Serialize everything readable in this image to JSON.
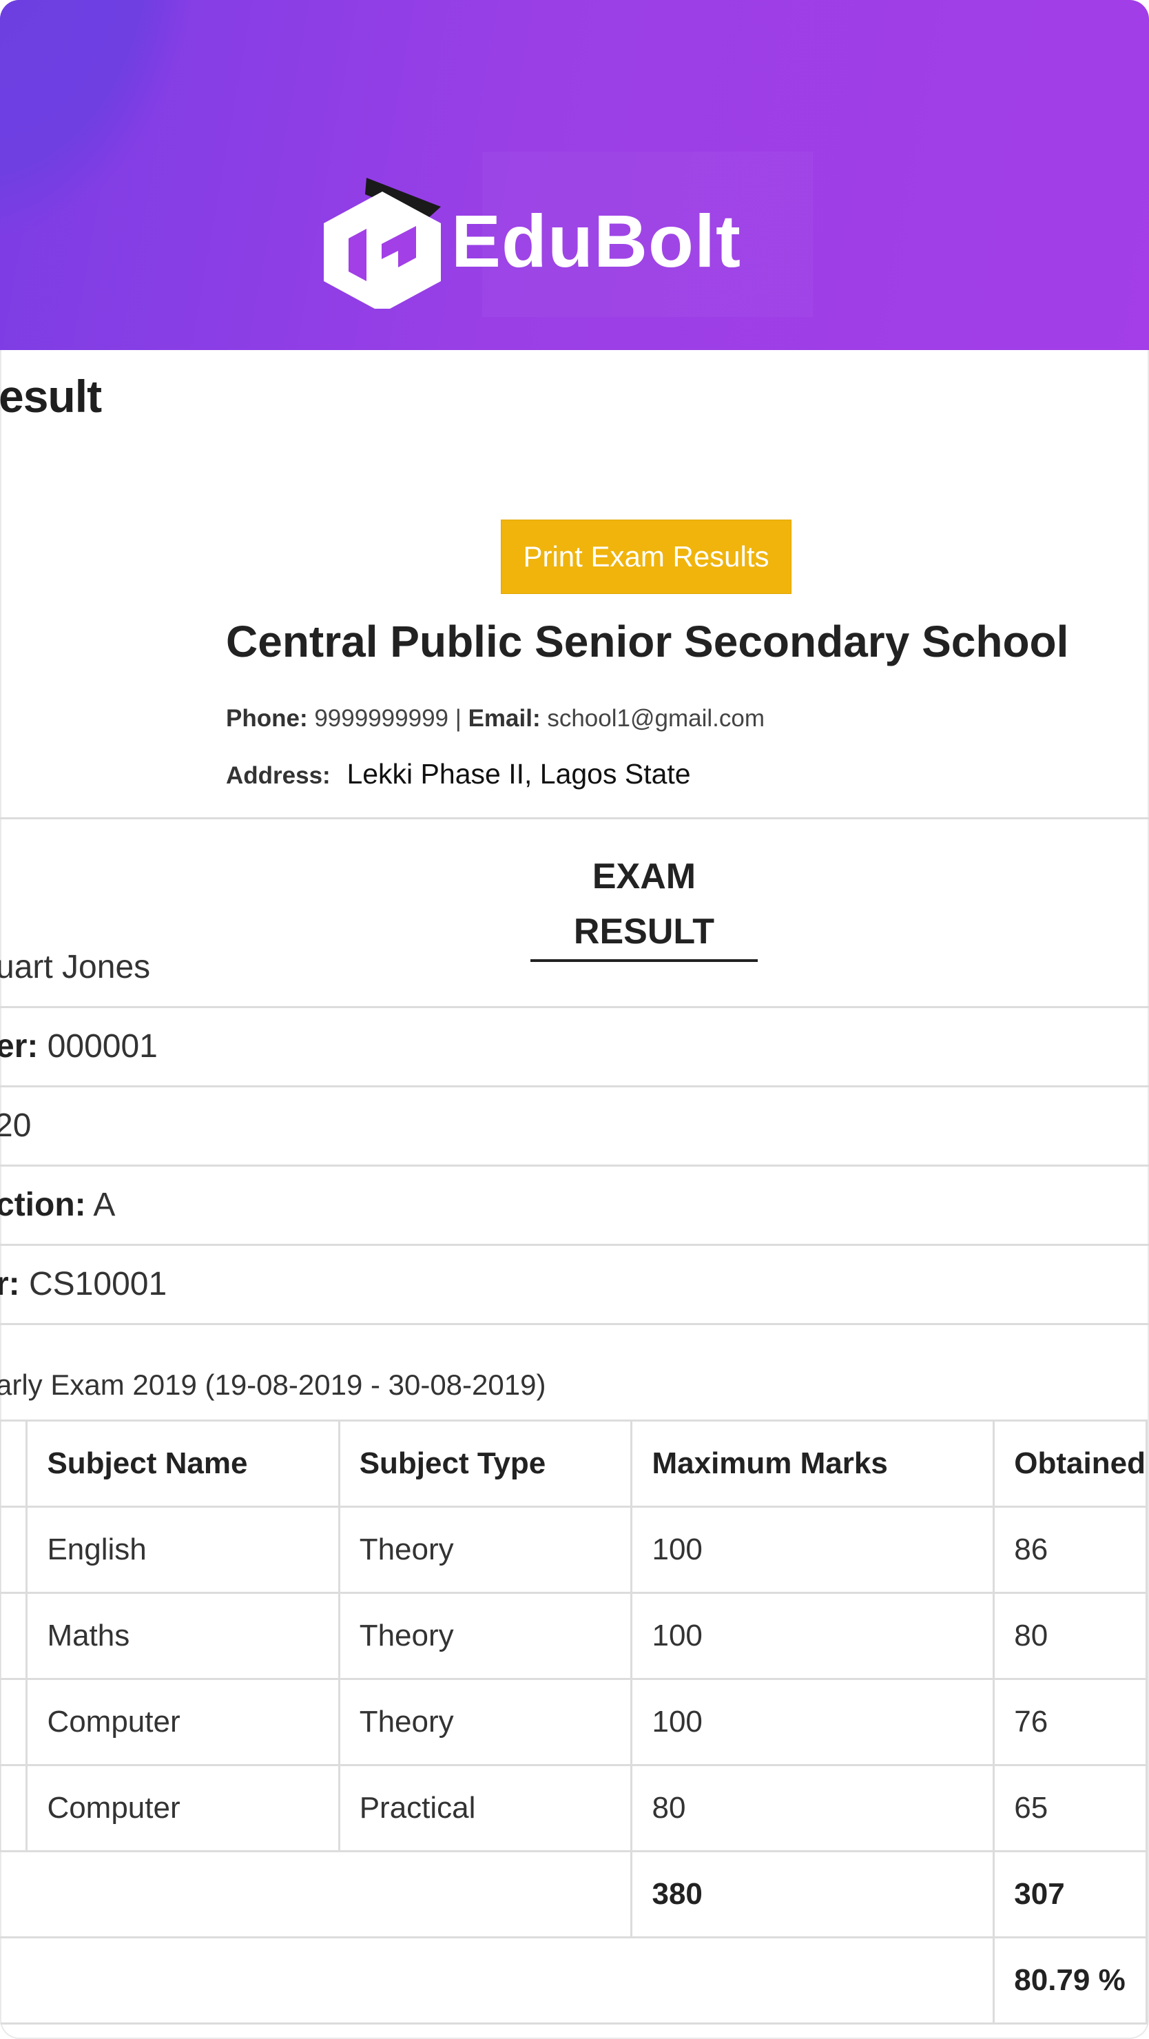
{
  "brand": {
    "name": "EduBolt",
    "logo_icon": "edubolt-logo-icon"
  },
  "page_title": "esult",
  "actions": {
    "print_label": "Print Exam Results"
  },
  "school": {
    "name": "Central Public Senior Secondary School",
    "phone_label": "Phone:",
    "phone": "9999999999",
    "separator": "|",
    "email_label": "Email:",
    "email": "school1@gmail.com",
    "address_label": "Address:",
    "address": "Lekki Phase II, Lagos State"
  },
  "section_title": "EXAM RESULT",
  "student_info": [
    {
      "label": "",
      "value": "uart Jones"
    },
    {
      "label": "er:",
      "value": "000001"
    },
    {
      "label": "",
      "value": "20"
    },
    {
      "label": "ction:",
      "value": "A"
    },
    {
      "label": "r:",
      "value": "CS10001"
    }
  ],
  "exam_line": "arly Exam 2019 (19-08-2019 - 30-08-2019)",
  "results": {
    "headers": [
      "Subject Name",
      "Subject Type",
      "Maximum Marks",
      "Obtained"
    ],
    "rows": [
      [
        "English",
        "Theory",
        "100",
        "86"
      ],
      [
        "Maths",
        "Theory",
        "100",
        "80"
      ],
      [
        "Computer",
        "Theory",
        "100",
        "76"
      ],
      [
        "Computer",
        "Practical",
        "80",
        "65"
      ]
    ],
    "total_max": "380",
    "total_obtained": "307",
    "percentage": "80.79 %"
  },
  "colors": {
    "banner_start": "#7b3de4",
    "banner_end": "#a33ee8",
    "print_button": "#f0b40c"
  }
}
